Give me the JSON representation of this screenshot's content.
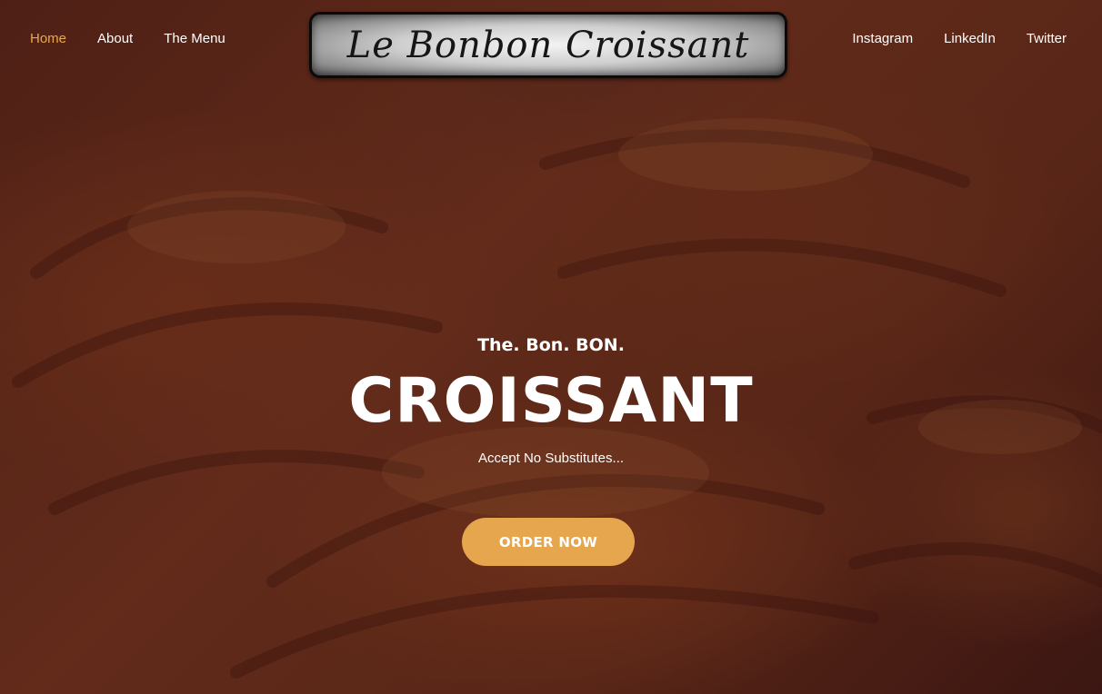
{
  "nav": {
    "left": [
      {
        "label": "Home",
        "active": true
      },
      {
        "label": "About",
        "active": false
      },
      {
        "label": "The Menu",
        "active": false
      }
    ],
    "right": [
      {
        "label": "Instagram"
      },
      {
        "label": "LinkedIn"
      },
      {
        "label": "Twitter"
      }
    ]
  },
  "logo": {
    "text": "Le Bonbon Croissant"
  },
  "hero": {
    "tagline": "The. Bon. BON.",
    "headline": "CROISSANT",
    "subtext": "Accept No Substitutes...",
    "cta_label": "ORDER NOW"
  },
  "colors": {
    "accent": "#e6a64e",
    "active_link": "#e8a94b",
    "text": "#ffffff"
  }
}
